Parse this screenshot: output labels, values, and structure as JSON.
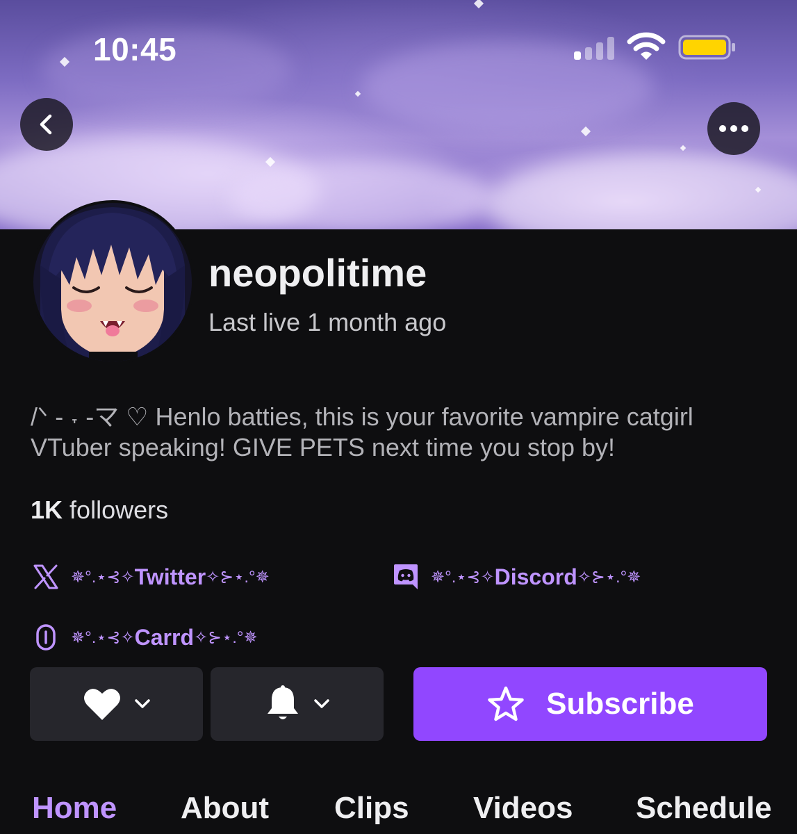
{
  "status_bar": {
    "time": "10:45"
  },
  "header": {
    "back_icon": "chevron-left-icon",
    "more_icon": "ellipsis-icon"
  },
  "channel": {
    "name": "neopolitime",
    "last_live": "Last live 1 month ago",
    "bio": "/ᐠ - ˕ -マ ♡ Henlo batties, this is your favorite vampire catgirl VTuber speaking! GIVE PETS next time you stop by!",
    "followers_count": "1K",
    "followers_label": "followers"
  },
  "links": [
    {
      "icon": "x-icon",
      "prefix": "✵°.⋆⊰✧",
      "label": "Twitter",
      "suffix": "✧⊱⋆.°✵"
    },
    {
      "icon": "discord-icon",
      "prefix": "✵°.⋆⊰✧",
      "label": " Discord",
      "suffix": "✧⊱⋆.°✵"
    },
    {
      "icon": "link-icon",
      "prefix": "✵°.⋆⊰✧",
      "label": "Carrd",
      "suffix": "✧⊱⋆.°✵"
    }
  ],
  "actions": {
    "follow_icon": "heart-icon",
    "notify_icon": "bell-icon",
    "subscribe_label": "Subscribe",
    "subscribe_icon": "star-icon"
  },
  "tabs": [
    {
      "label": "Home",
      "active": true
    },
    {
      "label": "About",
      "active": false
    },
    {
      "label": "Clips",
      "active": false
    },
    {
      "label": "Videos",
      "active": false
    },
    {
      "label": "Schedule",
      "active": false
    }
  ],
  "colors": {
    "accent": "#9147ff",
    "accent_text": "#bf94ff",
    "background": "#0e0e10",
    "button_dark": "#26262c",
    "battery": "#ffd400"
  }
}
